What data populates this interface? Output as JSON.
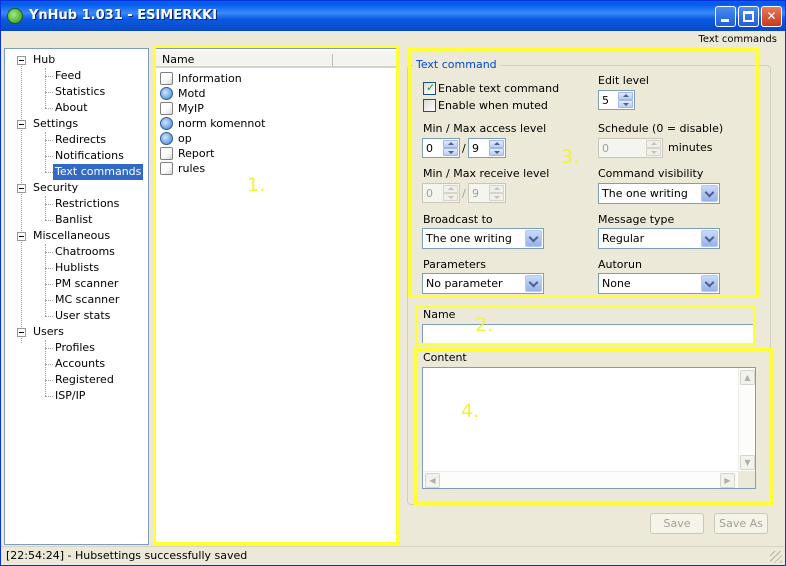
{
  "window": {
    "title": "YnHub 1.031 - ESIMERKKI",
    "minimize": "_",
    "close": "✕"
  },
  "section_label": "Text commands",
  "tree": {
    "groups": [
      {
        "label": "Hub",
        "children": [
          "Feed",
          "Statistics",
          "About"
        ]
      },
      {
        "label": "Settings",
        "children": [
          "Redirects",
          "Notifications",
          "Text commands"
        ]
      },
      {
        "label": "Security",
        "children": [
          "Restrictions",
          "Banlist"
        ]
      },
      {
        "label": "Miscellaneous",
        "children": [
          "Chatrooms",
          "Hublists",
          "PM scanner",
          "MC scanner",
          "User stats"
        ]
      },
      {
        "label": "Users",
        "children": [
          "Profiles",
          "Accounts",
          "Registered",
          "ISP/IP"
        ]
      }
    ],
    "selected": "Text commands"
  },
  "list": {
    "header": "Name",
    "items": [
      {
        "label": "Information",
        "icon": "document-icon"
      },
      {
        "label": "Motd",
        "icon": "globe-document-icon"
      },
      {
        "label": "MyIP",
        "icon": "document-icon"
      },
      {
        "label": "norm komennot",
        "icon": "globe-document-icon"
      },
      {
        "label": "op",
        "icon": "globe-document-icon"
      },
      {
        "label": "Report",
        "icon": "document-icon"
      },
      {
        "label": "rules",
        "icon": "document-icon"
      }
    ]
  },
  "form": {
    "group_title": "Text command",
    "enable_text_command": {
      "label": "Enable text command",
      "checked": true
    },
    "enable_when_muted": {
      "label": "Enable when muted",
      "checked": false
    },
    "edit_level": {
      "label": "Edit level",
      "value": "5"
    },
    "access_level": {
      "label": "Min / Max access level",
      "min": "0",
      "max": "9",
      "sep": "/"
    },
    "schedule": {
      "label": "Schedule (0 = disable)",
      "value": "0",
      "unit": "minutes"
    },
    "receive_level": {
      "label": "Min / Max receive level",
      "min": "0",
      "max": "9",
      "sep": "/"
    },
    "command_visibility": {
      "label": "Command visibility",
      "value": "The one writing"
    },
    "broadcast_to": {
      "label": "Broadcast to",
      "value": "The one writing"
    },
    "message_type": {
      "label": "Message type",
      "value": "Regular"
    },
    "parameters": {
      "label": "Parameters",
      "value": "No parameter"
    },
    "autorun": {
      "label": "Autorun",
      "value": "None"
    },
    "name": {
      "label": "Name",
      "value": ""
    },
    "content": {
      "label": "Content",
      "value": ""
    },
    "save": "Save",
    "save_as": "Save As"
  },
  "annotations": [
    "1.",
    "2.",
    "3.",
    "4."
  ],
  "annotation_color": "#ffff33",
  "status": "[22:54:24] - Hubsettings successfully saved"
}
